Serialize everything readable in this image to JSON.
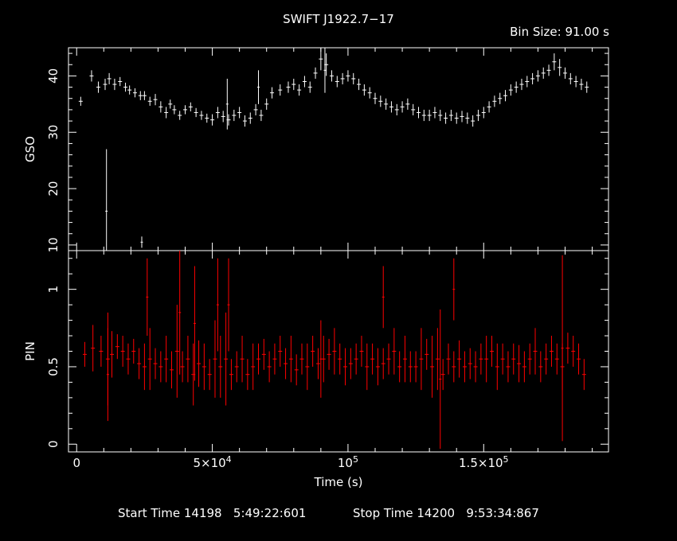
{
  "header": {
    "title": "SWIFT J1922.7−17",
    "bin_size": "Bin Size: 91.00 s"
  },
  "footer": {
    "start_time": "Start Time 14198   5:49:22:601",
    "stop_time": "Stop Time 14200   9:53:34:867"
  },
  "chart_data": {
    "type": "scatter",
    "title": "SWIFT J1922.7−17",
    "xlabel": "Time (s)",
    "xlim": [
      -3000,
      196000
    ],
    "xticks": [
      {
        "value": 0,
        "label": "0"
      },
      {
        "value": 50000,
        "label": "5×10⁴"
      },
      {
        "value": 100000,
        "label": "10⁵"
      },
      {
        "value": 150000,
        "label": "1.5×10⁵"
      }
    ],
    "colors": {
      "gso": "#ffffff",
      "pin": "#ff0000",
      "axes": "#ffffff"
    },
    "panels": [
      {
        "name": "GSO",
        "ylabel": "GSO",
        "ylim": [
          9,
          45
        ],
        "yticks": [
          {
            "value": 10,
            "label": "10"
          },
          {
            "value": 20,
            "label": "20"
          },
          {
            "value": 30,
            "label": "30"
          },
          {
            "value": 40,
            "label": "40"
          }
        ],
        "series": [
          {
            "x": [
              1500,
              5500,
              8000,
              10500,
              12000,
              14000,
              16000,
              18000,
              19500,
              21500,
              23500,
              25000,
              27000,
              29000,
              31000,
              33000,
              34500,
              36000,
              38000,
              40000,
              42000,
              44000,
              46000,
              48000,
              50000,
              52000,
              54000,
              56000,
              58000,
              60000,
              62000,
              64000,
              66000,
              68000,
              70000,
              72000,
              75000,
              78000,
              80000,
              82000,
              84000,
              86000,
              88000,
              90000,
              92000,
              94000,
              96000,
              98000,
              100000,
              102000,
              104000,
              106000,
              108000,
              110000,
              112000,
              114000,
              116000,
              118000,
              120000,
              122000,
              124000,
              126000,
              128000,
              130000,
              132000,
              134000,
              136000,
              138000,
              140000,
              142000,
              144000,
              146000,
              148000,
              150000,
              152000,
              154000,
              156000,
              158000,
              160000,
              162000,
              164000,
              166000,
              168000,
              170000,
              172000,
              174000,
              176000,
              178000,
              180000,
              182000,
              184000,
              186000,
              188000
            ],
            "y": [
              35.5,
              40,
              38,
              38.5,
              39.5,
              38.5,
              39,
              38,
              37.5,
              37,
              36.5,
              36.5,
              35.5,
              35.8,
              34.5,
              33.5,
              35,
              34,
              33,
              34,
              34.5,
              33.5,
              33,
              32.5,
              32.2,
              33.5,
              32.8,
              32.2,
              33,
              33.5,
              32,
              32.5,
              34,
              33,
              35,
              37,
              37.5,
              38,
              38.5,
              37.5,
              39,
              38,
              40.5,
              43,
              42,
              40,
              39,
              39.5,
              40,
              39.5,
              38.5,
              37.5,
              37,
              36,
              35.5,
              35,
              34.5,
              34,
              34.5,
              35,
              34,
              33.5,
              33,
              33,
              33.5,
              33,
              32.5,
              33,
              32.5,
              32.8,
              32.5,
              32,
              33,
              33.5,
              34.5,
              35.5,
              36,
              36.5,
              37.5,
              38,
              38.5,
              39,
              39.5,
              40,
              40.5,
              41,
              42.5,
              41.5,
              40.5,
              39.5,
              39,
              38.5,
              38
            ],
            "err": [
              0.8,
              1,
              1,
              1,
              1,
              1,
              0.8,
              0.8,
              0.8,
              0.8,
              0.8,
              0.8,
              0.8,
              1,
              1,
              1,
              0.8,
              0.8,
              0.8,
              0.8,
              0.8,
              0.8,
              0.8,
              0.8,
              1,
              1,
              1,
              1,
              1,
              1,
              1,
              1,
              1,
              1,
              1,
              1,
              1,
              1,
              1,
              1,
              1,
              1,
              1,
              2,
              2,
              1,
              1,
              1,
              1,
              1,
              1,
              1,
              1,
              1,
              1,
              1,
              1,
              1,
              1,
              1,
              1,
              1,
              1,
              1,
              1,
              1,
              1,
              1,
              1,
              1,
              1,
              1,
              1,
              1,
              1,
              1,
              1,
              1,
              1,
              1,
              1,
              1,
              1,
              1,
              1,
              1,
              1.5,
              1.5,
              1,
              1,
              1,
              1,
              1
            ]
          }
        ],
        "spikes": [
          {
            "x": 11000,
            "y": 16,
            "err": 11
          },
          {
            "x": 24000,
            "y": 10.5,
            "err": 1
          },
          {
            "x": 55500,
            "y": 35,
            "err": 4.5
          },
          {
            "x": 67000,
            "y": 38,
            "err": 3
          },
          {
            "x": 91500,
            "y": 41,
            "err": 4
          }
        ]
      },
      {
        "name": "PIN",
        "ylabel": "PIN",
        "ylim": [
          -0.05,
          1.25
        ],
        "yticks": [
          {
            "value": 0,
            "label": "0"
          },
          {
            "value": 0.5,
            "label": "0.5"
          },
          {
            "value": 1,
            "label": "1"
          }
        ],
        "series": [
          {
            "x": [
              3000,
              6000,
              9000,
              11500,
              13000,
              15000,
              17000,
              19000,
              21000,
              23000,
              25000,
              27000,
              29000,
              31000,
              33000,
              35000,
              37000,
              39000,
              41000,
              43000,
              45000,
              47000,
              49000,
              51000,
              53000,
              55000,
              57000,
              59000,
              61000,
              63000,
              65000,
              67000,
              69000,
              71000,
              73000,
              75000,
              77000,
              79000,
              81000,
              83000,
              85000,
              87000,
              89000,
              91000,
              93000,
              95000,
              97000,
              99000,
              101000,
              103000,
              105000,
              107000,
              109000,
              111000,
              113000,
              115000,
              117000,
              119000,
              121000,
              123000,
              125000,
              127000,
              129000,
              131000,
              133000,
              135000,
              137000,
              139000,
              141000,
              143000,
              145000,
              147000,
              149000,
              151000,
              153000,
              155000,
              157000,
              159000,
              161000,
              163000,
              165000,
              167000,
              169000,
              171000,
              173000,
              175000,
              177000,
              179000,
              181000,
              183000,
              185000,
              187000
            ],
            "y": [
              0.58,
              0.62,
              0.6,
              0.55,
              0.58,
              0.63,
              0.6,
              0.55,
              0.6,
              0.52,
              0.5,
              0.55,
              0.52,
              0.5,
              0.55,
              0.48,
              0.6,
              0.5,
              0.55,
              0.45,
              0.52,
              0.5,
              0.45,
              0.55,
              0.5,
              0.55,
              0.45,
              0.5,
              0.55,
              0.45,
              0.5,
              0.55,
              0.58,
              0.5,
              0.55,
              0.6,
              0.52,
              0.55,
              0.48,
              0.55,
              0.5,
              0.6,
              0.52,
              0.55,
              0.58,
              0.6,
              0.55,
              0.5,
              0.52,
              0.55,
              0.6,
              0.5,
              0.55,
              0.5,
              0.52,
              0.55,
              0.6,
              0.5,
              0.55,
              0.5,
              0.5,
              0.55,
              0.58,
              0.5,
              0.55,
              0.45,
              0.55,
              0.5,
              0.55,
              0.5,
              0.52,
              0.5,
              0.55,
              0.55,
              0.6,
              0.5,
              0.55,
              0.5,
              0.55,
              0.52,
              0.5,
              0.55,
              0.6,
              0.5,
              0.55,
              0.6,
              0.55,
              0.5,
              0.62,
              0.6,
              0.55,
              0.45
            ],
            "err": [
              0.08,
              0.15,
              0.1,
              0.3,
              0.15,
              0.08,
              0.1,
              0.1,
              0.08,
              0.1,
              0.15,
              0.2,
              0.1,
              0.1,
              0.15,
              0.12,
              0.3,
              0.1,
              0.15,
              0.2,
              0.15,
              0.15,
              0.1,
              0.25,
              0.2,
              0.3,
              0.1,
              0.1,
              0.15,
              0.1,
              0.15,
              0.1,
              0.1,
              0.1,
              0.1,
              0.1,
              0.1,
              0.15,
              0.1,
              0.1,
              0.15,
              0.1,
              0.1,
              0.15,
              0.1,
              0.15,
              0.1,
              0.12,
              0.1,
              0.1,
              0.1,
              0.15,
              0.1,
              0.12,
              0.1,
              0.1,
              0.15,
              0.1,
              0.15,
              0.1,
              0.1,
              0.2,
              0.1,
              0.2,
              0.2,
              0.1,
              0.1,
              0.1,
              0.12,
              0.1,
              0.1,
              0.1,
              0.1,
              0.15,
              0.1,
              0.15,
              0.1,
              0.1,
              0.1,
              0.12,
              0.1,
              0.1,
              0.15,
              0.1,
              0.1,
              0.1,
              0.1,
              0.15,
              0.1,
              0.1,
              0.1,
              0.1
            ]
          }
        ],
        "spikes": [
          {
            "x": 11500,
            "y": 0.45,
            "err": 0.3
          },
          {
            "x": 26000,
            "y": 0.95,
            "err": 0.25
          },
          {
            "x": 38000,
            "y": 0.85,
            "err": 0.4
          },
          {
            "x": 43500,
            "y": 0.78,
            "err": 0.37
          },
          {
            "x": 52000,
            "y": 0.9,
            "err": 0.3
          },
          {
            "x": 56000,
            "y": 0.9,
            "err": 0.3
          },
          {
            "x": 90000,
            "y": 0.55,
            "err": 0.25
          },
          {
            "x": 113000,
            "y": 0.95,
            "err": 0.2
          },
          {
            "x": 134000,
            "y": 0.42,
            "err": 0.45
          },
          {
            "x": 139000,
            "y": 1.0,
            "err": 0.2
          },
          {
            "x": 179000,
            "y": 0.62,
            "err": 0.6
          }
        ]
      }
    ]
  }
}
